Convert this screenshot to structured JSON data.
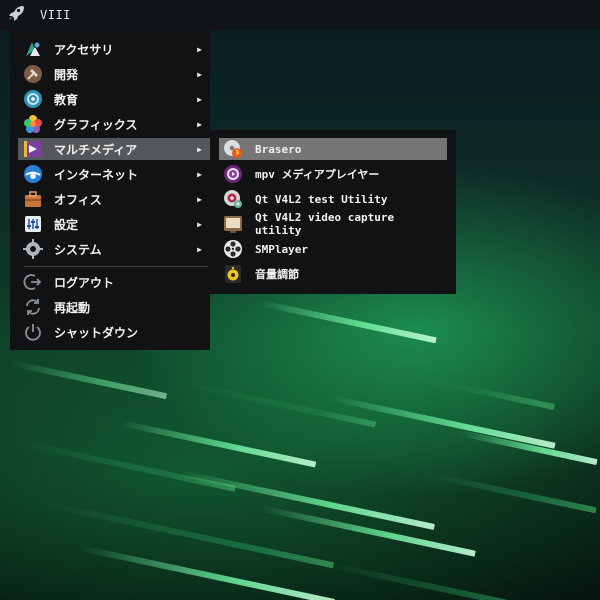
{
  "panel": {
    "launcher_icon": "rocket-icon",
    "title": "VIII"
  },
  "menu": {
    "items": [
      {
        "label": "アクセサリ",
        "icon": "accessories-icon"
      },
      {
        "label": "開発",
        "icon": "development-icon"
      },
      {
        "label": "教育",
        "icon": "education-icon"
      },
      {
        "label": "グラフィックス",
        "icon": "graphics-icon"
      },
      {
        "label": "マルチメディア",
        "icon": "multimedia-icon",
        "selected": true
      },
      {
        "label": "インターネット",
        "icon": "internet-icon"
      },
      {
        "label": "オフィス",
        "icon": "office-icon"
      },
      {
        "label": "設定",
        "icon": "settings-icon"
      },
      {
        "label": "システム",
        "icon": "system-icon"
      }
    ],
    "session": [
      {
        "label": "ログアウト",
        "icon": "logout-icon"
      },
      {
        "label": "再起動",
        "icon": "restart-icon"
      },
      {
        "label": "シャットダウン",
        "icon": "shutdown-icon"
      }
    ],
    "submenu_arrow": "▶"
  },
  "submenu": {
    "items": [
      {
        "label": "Brasero",
        "icon": "brasero-icon",
        "selected": true
      },
      {
        "label": "mpv メディアプレイヤー",
        "icon": "mpv-icon"
      },
      {
        "label": "Qt V4L2 test Utility",
        "icon": "qv4l2-icon"
      },
      {
        "label": "Qt V4L2 video capture utility",
        "icon": "qvidcap-icon"
      },
      {
        "label": "SMPlayer",
        "icon": "smplayer-icon"
      },
      {
        "label": "音量調節",
        "icon": "volume-control-icon"
      }
    ]
  },
  "colors": {
    "panel_bg": "#101416",
    "menu_bg": "#101214",
    "menu_highlight": "#55585b",
    "submenu_highlight": "#757575",
    "text": "#f2f2f2"
  }
}
